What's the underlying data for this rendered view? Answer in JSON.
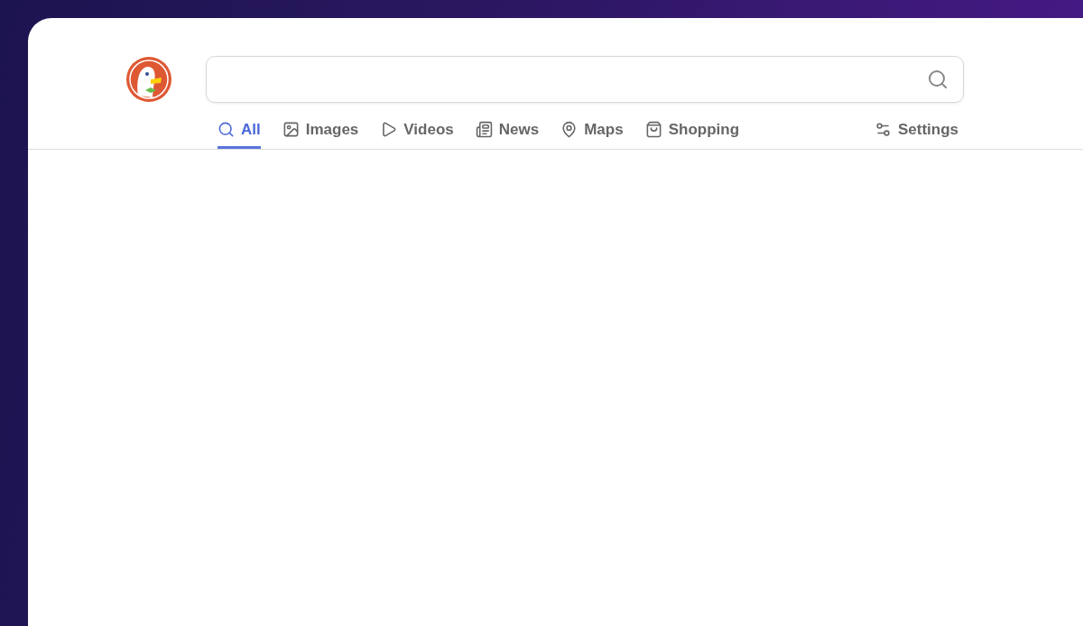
{
  "tabs": [
    {
      "kind": "all",
      "label": "All",
      "selected": true
    },
    {
      "kind": "images",
      "label": "Images",
      "selected": false
    },
    {
      "kind": "videos",
      "label": "Videos",
      "selected": false
    },
    {
      "kind": "news",
      "label": "News",
      "selected": false
    },
    {
      "kind": "maps",
      "label": "Maps",
      "selected": false
    },
    {
      "kind": "shopping",
      "label": "Shopping",
      "selected": false
    }
  ],
  "settings": {
    "label": "Settings"
  }
}
